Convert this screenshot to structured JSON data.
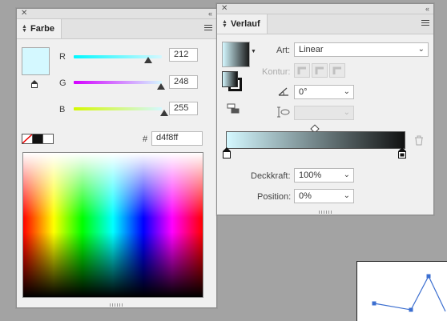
{
  "farbe": {
    "tab_label": "Farbe",
    "channels": [
      {
        "label": "R",
        "value": "212"
      },
      {
        "label": "G",
        "value": "248"
      },
      {
        "label": "B",
        "value": "255"
      }
    ],
    "hash_label": "#",
    "hex_value": "d4f8ff",
    "swatch_color": "#d4f8ff"
  },
  "verlauf": {
    "tab_label": "Verlauf",
    "art_label": "Art:",
    "art_value": "Linear",
    "kontur_label": "Kontur:",
    "angle_value": "0°",
    "deckkraft_label": "Deckkraft:",
    "deckkraft_value": "100%",
    "position_label": "Position:",
    "position_value": "0%",
    "gradient_start": "#d4f8ff",
    "gradient_end": "#111111"
  },
  "icons": {
    "close": "close-icon",
    "collapse": "collapse-icon",
    "menu": "panel-menu-icon",
    "trash": "trash-icon",
    "angle": "angle-icon",
    "aspect": "aspect-ratio-icon"
  }
}
